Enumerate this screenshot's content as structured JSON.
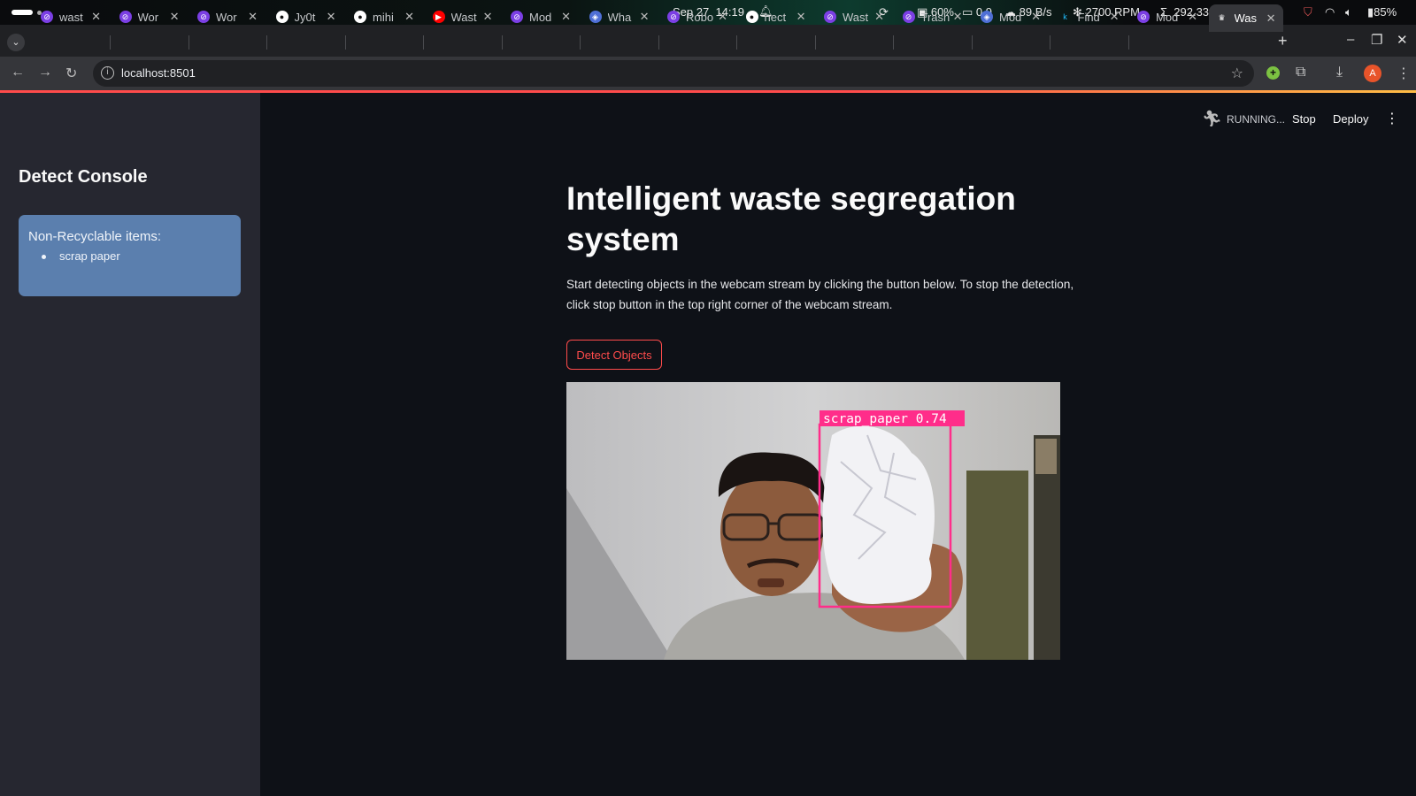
{
  "os_bar": {
    "date": "Sep 27",
    "time": "14:19",
    "cpu": "60%",
    "load": "0.9",
    "net": "89 B/s",
    "fan": "2700 RPM",
    "mem": "292.33 MB",
    "battery": "85%"
  },
  "browser": {
    "tabs": [
      {
        "label": "wast",
        "icon": "tab-favicon-purple"
      },
      {
        "label": "Wor",
        "icon": "tab-favicon-purple"
      },
      {
        "label": "Wor",
        "icon": "tab-favicon-purple"
      },
      {
        "label": "Jy0t",
        "icon": "github-icon"
      },
      {
        "label": "mihi",
        "icon": "github-icon"
      },
      {
        "label": "Wast",
        "icon": "youtube-icon"
      },
      {
        "label": "Mod",
        "icon": "tab-favicon-purple"
      },
      {
        "label": "Wha",
        "icon": "tab-favicon-globe"
      },
      {
        "label": "Robo",
        "icon": "tab-favicon-purple"
      },
      {
        "label": "hect",
        "icon": "github-icon"
      },
      {
        "label": "Wast",
        "icon": "tab-favicon-purple"
      },
      {
        "label": "Trash",
        "icon": "tab-favicon-purple"
      },
      {
        "label": "Mod",
        "icon": "tab-favicon-globe"
      },
      {
        "label": "Find",
        "icon": "kaggle-icon"
      },
      {
        "label": "Mod",
        "icon": "tab-favicon-purple"
      },
      {
        "label": "Was",
        "icon": "streamlit-icon",
        "active": true
      }
    ],
    "url": "localhost:8501",
    "avatar_letter": "A"
  },
  "app": {
    "status": "RUNNING...",
    "stop_label": "Stop",
    "deploy_label": "Deploy",
    "sidebar": {
      "title": "Detect Console",
      "info_heading": "Non-Recyclable items:",
      "items": [
        "scrap paper"
      ]
    },
    "title": "Intelligent waste segregation system",
    "description": "Start detecting objects in the webcam stream by clicking the button below. To stop the detection, click stop button in the top right corner of the webcam stream.",
    "detect_button": "Detect Objects",
    "detection": {
      "label": "scrap_paper 0.74",
      "box_color": "#ff2d8a"
    }
  },
  "colors": {
    "accent": "#ff4b4b",
    "sidebar_bg": "#262730",
    "main_bg": "#0e1117",
    "info_box": "#5b7fae"
  }
}
